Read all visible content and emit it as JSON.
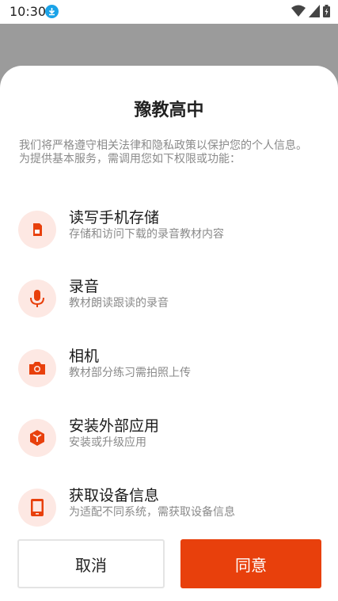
{
  "status": {
    "time": "10:30"
  },
  "dialog": {
    "title": "豫教高中",
    "intro": "我们将严格遵守相关法律和隐私政策以保护您的个人信息。为提供基本服务，需调用您如下权限或功能：",
    "permissions": [
      {
        "icon": "storage-icon",
        "title": "读写手机存储",
        "desc": "存储和访问下载的录音教材内容"
      },
      {
        "icon": "microphone-icon",
        "title": "录音",
        "desc": "教材朗读跟读的录音"
      },
      {
        "icon": "camera-icon",
        "title": "相机",
        "desc": "教材部分练习需拍照上传"
      },
      {
        "icon": "package-icon",
        "title": "安装外部应用",
        "desc": "安装或升级应用"
      },
      {
        "icon": "phone-icon",
        "title": "获取设备信息",
        "desc": "为适配不同系统，需获取设备信息"
      }
    ],
    "cancel_label": "取消",
    "agree_label": "同意"
  },
  "colors": {
    "accent": "#e8400c",
    "icon_bg": "#fde8e3",
    "overlay": "#9b9b9b"
  }
}
